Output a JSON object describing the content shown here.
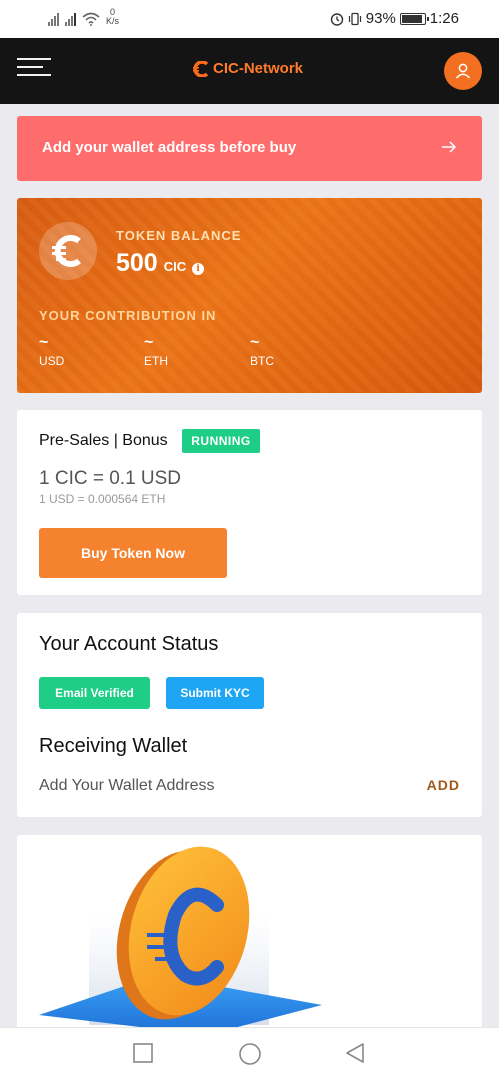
{
  "status_bar": {
    "speed_value": "0",
    "speed_unit": "K/s",
    "battery": "93%",
    "time": "1:26"
  },
  "header": {
    "brand": "CIC-Network"
  },
  "alert": {
    "text": "Add your wallet address before buy"
  },
  "balance": {
    "label": "TOKEN BALANCE",
    "value": "500",
    "unit": "CIC",
    "contribution_label": "YOUR CONTRIBUTION IN",
    "currencies": [
      {
        "value": "~",
        "code": "USD"
      },
      {
        "value": "~",
        "code": "ETH"
      },
      {
        "value": "~",
        "code": "BTC"
      }
    ]
  },
  "presale": {
    "title": "Pre-Sales | Bonus",
    "badge": "RUNNING",
    "rate": "1 CIC = 0.1 USD",
    "rate_sub": "1 USD = 0.000564 ETH",
    "buy_label": "Buy Token Now"
  },
  "account": {
    "title": "Your Account Status",
    "email_label": "Email Verified",
    "kyc_label": "Submit KYC",
    "wallet_title": "Receiving Wallet",
    "wallet_sub": "Add Your Wallet Address",
    "add_label": "ADD"
  },
  "colors": {
    "accent": "#f36f21",
    "alert": "#ff6c6c",
    "success": "#1fce86",
    "info": "#1ea5f3"
  }
}
